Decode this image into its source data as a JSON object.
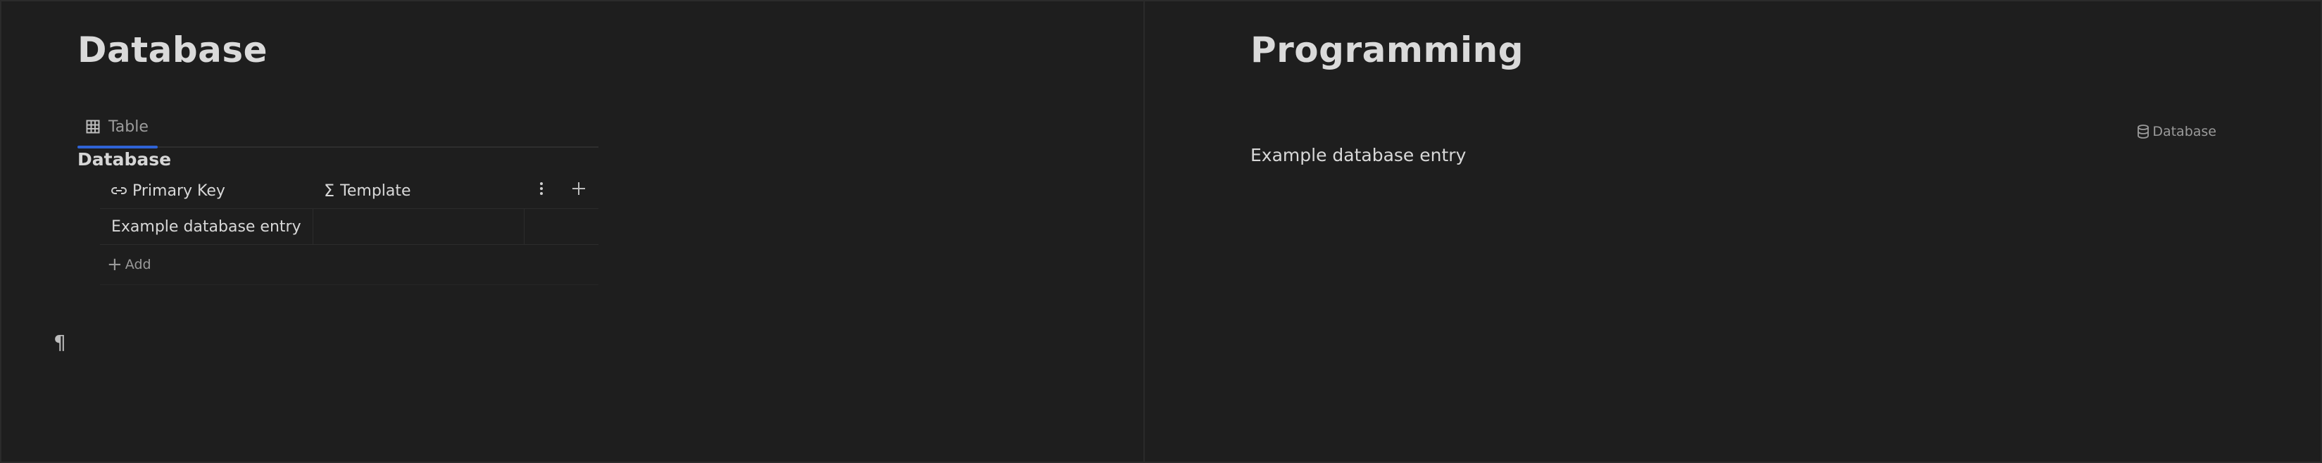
{
  "left_pane": {
    "title": "Database",
    "view_tabs": [
      {
        "label": "Table",
        "icon": "table-icon",
        "active": true
      }
    ],
    "database_heading": "Database",
    "table": {
      "columns": [
        {
          "label": "Primary Key",
          "icon": "link-icon"
        },
        {
          "label": "Template",
          "icon": "sigma-icon"
        }
      ],
      "column_menu_icon": "vertical-ellipsis-icon",
      "add_column_icon": "plus-icon",
      "rows": [
        {
          "primary_key": "Example database entry",
          "template": ""
        }
      ],
      "add_label": "Add"
    },
    "pilcrow": "¶"
  },
  "right_pane": {
    "title": "Programming",
    "database_badge": "Database",
    "entry_text": "Example database entry"
  },
  "colors": {
    "background": "#1e1e1e",
    "accent": "#2f63d6",
    "text": "#dcdcdc",
    "muted": "#9a9a9a"
  }
}
